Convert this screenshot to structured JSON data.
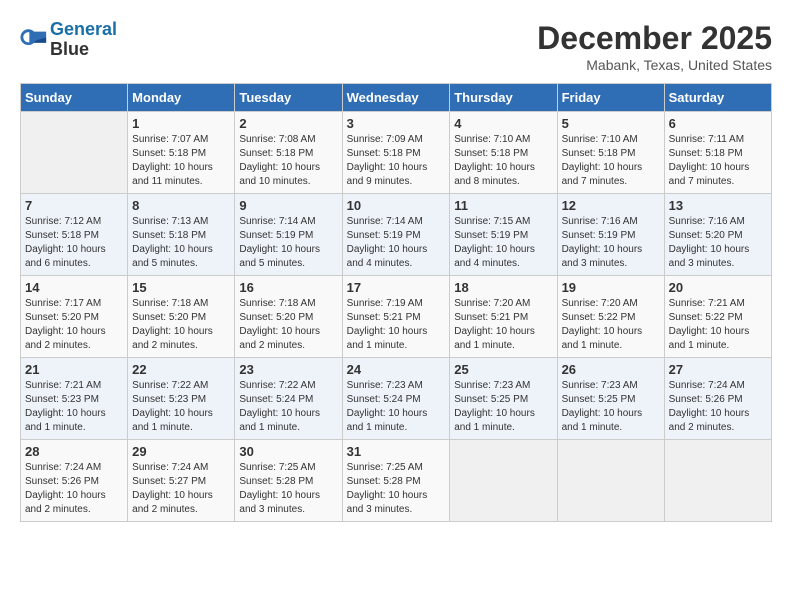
{
  "header": {
    "logo_line1": "General",
    "logo_line2": "Blue",
    "month": "December 2025",
    "location": "Mabank, Texas, United States"
  },
  "weekdays": [
    "Sunday",
    "Monday",
    "Tuesday",
    "Wednesday",
    "Thursday",
    "Friday",
    "Saturday"
  ],
  "weeks": [
    [
      {
        "num": "",
        "sunrise": "",
        "sunset": "",
        "daylight": ""
      },
      {
        "num": "1",
        "sunrise": "Sunrise: 7:07 AM",
        "sunset": "Sunset: 5:18 PM",
        "daylight": "Daylight: 10 hours and 11 minutes."
      },
      {
        "num": "2",
        "sunrise": "Sunrise: 7:08 AM",
        "sunset": "Sunset: 5:18 PM",
        "daylight": "Daylight: 10 hours and 10 minutes."
      },
      {
        "num": "3",
        "sunrise": "Sunrise: 7:09 AM",
        "sunset": "Sunset: 5:18 PM",
        "daylight": "Daylight: 10 hours and 9 minutes."
      },
      {
        "num": "4",
        "sunrise": "Sunrise: 7:10 AM",
        "sunset": "Sunset: 5:18 PM",
        "daylight": "Daylight: 10 hours and 8 minutes."
      },
      {
        "num": "5",
        "sunrise": "Sunrise: 7:10 AM",
        "sunset": "Sunset: 5:18 PM",
        "daylight": "Daylight: 10 hours and 7 minutes."
      },
      {
        "num": "6",
        "sunrise": "Sunrise: 7:11 AM",
        "sunset": "Sunset: 5:18 PM",
        "daylight": "Daylight: 10 hours and 7 minutes."
      }
    ],
    [
      {
        "num": "7",
        "sunrise": "Sunrise: 7:12 AM",
        "sunset": "Sunset: 5:18 PM",
        "daylight": "Daylight: 10 hours and 6 minutes."
      },
      {
        "num": "8",
        "sunrise": "Sunrise: 7:13 AM",
        "sunset": "Sunset: 5:18 PM",
        "daylight": "Daylight: 10 hours and 5 minutes."
      },
      {
        "num": "9",
        "sunrise": "Sunrise: 7:14 AM",
        "sunset": "Sunset: 5:19 PM",
        "daylight": "Daylight: 10 hours and 5 minutes."
      },
      {
        "num": "10",
        "sunrise": "Sunrise: 7:14 AM",
        "sunset": "Sunset: 5:19 PM",
        "daylight": "Daylight: 10 hours and 4 minutes."
      },
      {
        "num": "11",
        "sunrise": "Sunrise: 7:15 AM",
        "sunset": "Sunset: 5:19 PM",
        "daylight": "Daylight: 10 hours and 4 minutes."
      },
      {
        "num": "12",
        "sunrise": "Sunrise: 7:16 AM",
        "sunset": "Sunset: 5:19 PM",
        "daylight": "Daylight: 10 hours and 3 minutes."
      },
      {
        "num": "13",
        "sunrise": "Sunrise: 7:16 AM",
        "sunset": "Sunset: 5:20 PM",
        "daylight": "Daylight: 10 hours and 3 minutes."
      }
    ],
    [
      {
        "num": "14",
        "sunrise": "Sunrise: 7:17 AM",
        "sunset": "Sunset: 5:20 PM",
        "daylight": "Daylight: 10 hours and 2 minutes."
      },
      {
        "num": "15",
        "sunrise": "Sunrise: 7:18 AM",
        "sunset": "Sunset: 5:20 PM",
        "daylight": "Daylight: 10 hours and 2 minutes."
      },
      {
        "num": "16",
        "sunrise": "Sunrise: 7:18 AM",
        "sunset": "Sunset: 5:20 PM",
        "daylight": "Daylight: 10 hours and 2 minutes."
      },
      {
        "num": "17",
        "sunrise": "Sunrise: 7:19 AM",
        "sunset": "Sunset: 5:21 PM",
        "daylight": "Daylight: 10 hours and 1 minute."
      },
      {
        "num": "18",
        "sunrise": "Sunrise: 7:20 AM",
        "sunset": "Sunset: 5:21 PM",
        "daylight": "Daylight: 10 hours and 1 minute."
      },
      {
        "num": "19",
        "sunrise": "Sunrise: 7:20 AM",
        "sunset": "Sunset: 5:22 PM",
        "daylight": "Daylight: 10 hours and 1 minute."
      },
      {
        "num": "20",
        "sunrise": "Sunrise: 7:21 AM",
        "sunset": "Sunset: 5:22 PM",
        "daylight": "Daylight: 10 hours and 1 minute."
      }
    ],
    [
      {
        "num": "21",
        "sunrise": "Sunrise: 7:21 AM",
        "sunset": "Sunset: 5:23 PM",
        "daylight": "Daylight: 10 hours and 1 minute."
      },
      {
        "num": "22",
        "sunrise": "Sunrise: 7:22 AM",
        "sunset": "Sunset: 5:23 PM",
        "daylight": "Daylight: 10 hours and 1 minute."
      },
      {
        "num": "23",
        "sunrise": "Sunrise: 7:22 AM",
        "sunset": "Sunset: 5:24 PM",
        "daylight": "Daylight: 10 hours and 1 minute."
      },
      {
        "num": "24",
        "sunrise": "Sunrise: 7:23 AM",
        "sunset": "Sunset: 5:24 PM",
        "daylight": "Daylight: 10 hours and 1 minute."
      },
      {
        "num": "25",
        "sunrise": "Sunrise: 7:23 AM",
        "sunset": "Sunset: 5:25 PM",
        "daylight": "Daylight: 10 hours and 1 minute."
      },
      {
        "num": "26",
        "sunrise": "Sunrise: 7:23 AM",
        "sunset": "Sunset: 5:25 PM",
        "daylight": "Daylight: 10 hours and 1 minute."
      },
      {
        "num": "27",
        "sunrise": "Sunrise: 7:24 AM",
        "sunset": "Sunset: 5:26 PM",
        "daylight": "Daylight: 10 hours and 2 minutes."
      }
    ],
    [
      {
        "num": "28",
        "sunrise": "Sunrise: 7:24 AM",
        "sunset": "Sunset: 5:26 PM",
        "daylight": "Daylight: 10 hours and 2 minutes."
      },
      {
        "num": "29",
        "sunrise": "Sunrise: 7:24 AM",
        "sunset": "Sunset: 5:27 PM",
        "daylight": "Daylight: 10 hours and 2 minutes."
      },
      {
        "num": "30",
        "sunrise": "Sunrise: 7:25 AM",
        "sunset": "Sunset: 5:28 PM",
        "daylight": "Daylight: 10 hours and 3 minutes."
      },
      {
        "num": "31",
        "sunrise": "Sunrise: 7:25 AM",
        "sunset": "Sunset: 5:28 PM",
        "daylight": "Daylight: 10 hours and 3 minutes."
      },
      {
        "num": "",
        "sunrise": "",
        "sunset": "",
        "daylight": ""
      },
      {
        "num": "",
        "sunrise": "",
        "sunset": "",
        "daylight": ""
      },
      {
        "num": "",
        "sunrise": "",
        "sunset": "",
        "daylight": ""
      }
    ]
  ]
}
